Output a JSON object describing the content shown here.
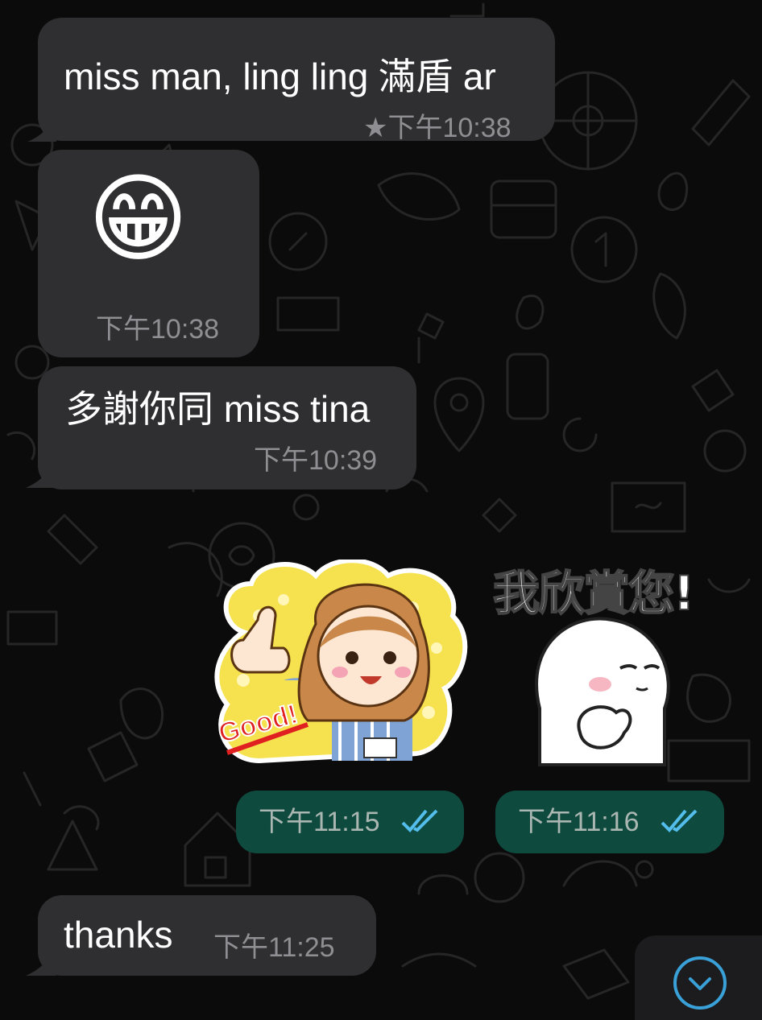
{
  "chat": {
    "messages": [
      {
        "text": "miss man, ling ling 滿盾 ar",
        "star": "★",
        "time": "下午10:38"
      },
      {
        "emoji": "😁",
        "time": "下午10:38"
      },
      {
        "text": "多謝你同 miss tina",
        "time": "下午10:39"
      },
      {
        "sticker": "Good!",
        "time": "下午11:15"
      },
      {
        "sticker": "我欣賞您!",
        "time": "下午11:16"
      },
      {
        "text": "thanks",
        "time": "下午11:25"
      }
    ]
  },
  "colors": {
    "incoming_bubble": "#2f2f31",
    "outgoing_bubble": "#0f4a3e",
    "read_ticks": "#53bdeb",
    "scroll_button_accent": "#3aa0d8"
  },
  "icons": {
    "star": "star-icon",
    "read_receipt": "double-check-icon",
    "scroll_down": "chevron-down-icon"
  }
}
